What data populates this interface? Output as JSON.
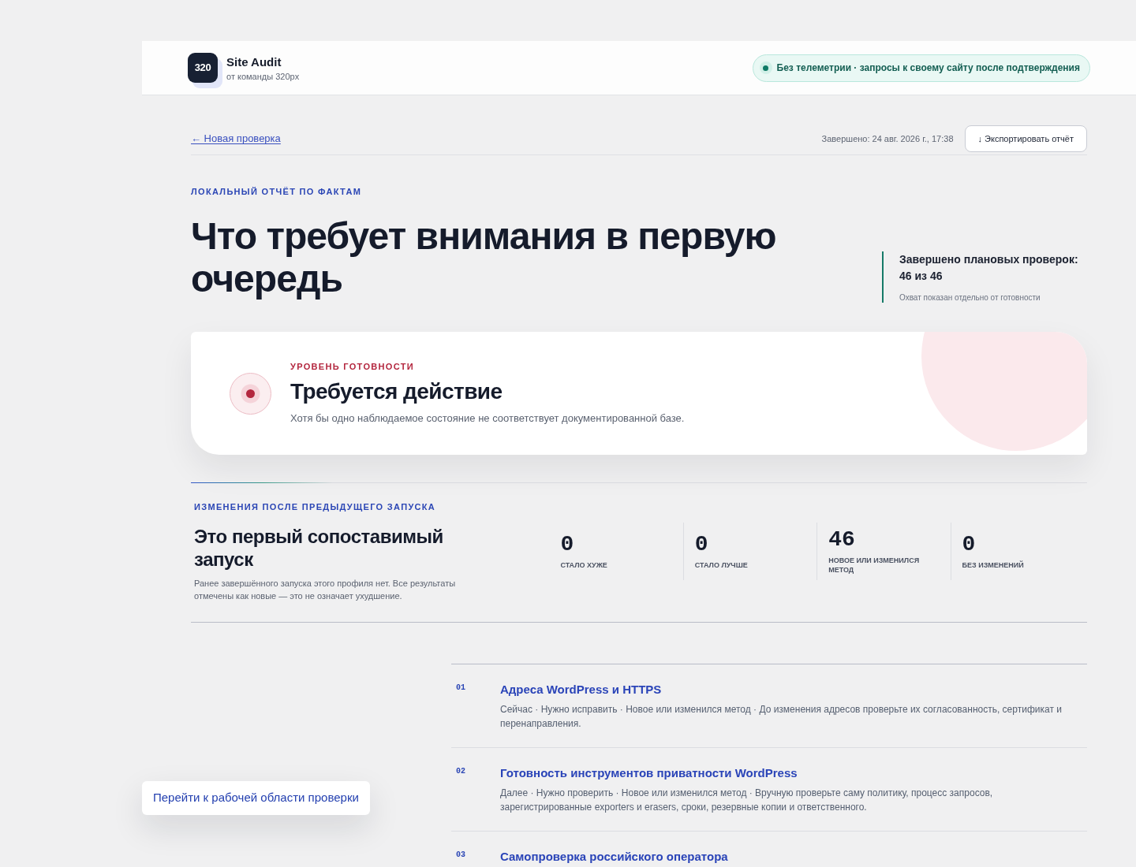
{
  "header": {
    "logo": "320",
    "title": "Site Audit",
    "subtitle": "от команды 320px",
    "privacy_badge": "Без телеметрии · запросы к своему сайту после подтверждения"
  },
  "toolbar": {
    "back_link": "← Новая проверка",
    "completed": "Завершено: 24 авг. 2026 г., 17:38",
    "export_button": "↓ Экспортировать отчёт"
  },
  "hero": {
    "eyebrow": "ЛОКАЛЬНЫЙ ОТЧЁТ ПО ФАКТАМ",
    "title": "Что требует внимания в первую очередь",
    "summary": "Завершено плановых проверок: 46 из 46",
    "summary_note": "Охват показан отдельно от готовности"
  },
  "readiness": {
    "eyebrow": "УРОВЕНЬ ГОТОВНОСТИ",
    "status": "Требуется действие",
    "description": "Хотя бы одно наблюдаемое состояние не соответствует документированной базе."
  },
  "changes": {
    "eyebrow": "ИЗМЕНЕНИЯ ПОСЛЕ ПРЕДЫДУЩЕГО ЗАПУСКА",
    "title": "Это первый сопоставимый запуск",
    "description": "Ранее завершённого запуска этого профиля нет. Все результаты отмечены как новые — это не означает ухудшение.",
    "stats": [
      {
        "value": "0",
        "label": "СТАЛО ХУЖЕ"
      },
      {
        "value": "0",
        "label": "СТАЛО ЛУЧШЕ"
      },
      {
        "value": "46",
        "label": "НОВОЕ ИЛИ ИЗМЕНИЛСЯ МЕТОД"
      },
      {
        "value": "0",
        "label": "БЕЗ ИЗМЕНЕНИЙ"
      }
    ]
  },
  "checks": [
    {
      "number": "01",
      "title": "Адреса WordPress и HTTPS",
      "description": "Сейчас · Нужно исправить · Новое или изменился метод · До изменения адресов проверьте их согласованность, сертификат и перенаправления."
    },
    {
      "number": "02",
      "title": "Готовность инструментов приватности WordPress",
      "description": "Далее · Нужно проверить · Новое или изменился метод · Вручную проверьте саму политику, процесс запросов, зарегистрированные exporters и erasers, сроки, резервные копии и ответственного."
    },
    {
      "number": "03",
      "title": "Самопроверка российского оператора"
    }
  ],
  "skip_link": "Перейти к рабочей области проверки"
}
